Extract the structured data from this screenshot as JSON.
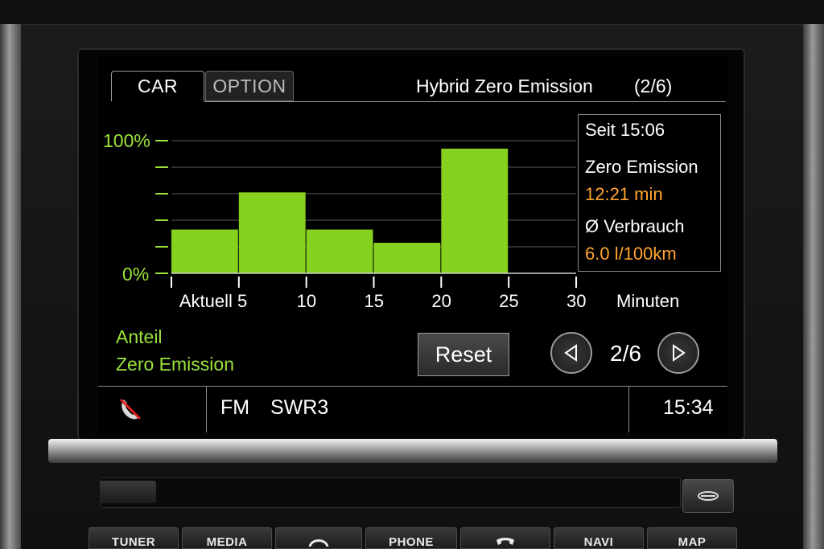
{
  "header": {
    "tabs": [
      {
        "label": "CAR",
        "active": true
      },
      {
        "label": "OPTION",
        "active": false
      }
    ],
    "title": "Hybrid Zero Emission",
    "page_indicator": "(2/6)"
  },
  "chart_data": {
    "type": "bar",
    "y_tick_labels": [
      "100%",
      "0%"
    ],
    "x_tick_labels": [
      "Aktuell 5",
      "10",
      "15",
      "20",
      "25",
      "30"
    ],
    "xlabel": "Minuten",
    "x_range": [
      0,
      30
    ],
    "ylim": [
      0,
      100
    ],
    "bars": [
      {
        "x0": 0,
        "x1": 5,
        "value": 33
      },
      {
        "x0": 5,
        "x1": 10,
        "value": 61
      },
      {
        "x0": 10,
        "x1": 15,
        "value": 33
      },
      {
        "x0": 15,
        "x1": 20,
        "value": 23
      },
      {
        "x0": 20,
        "x1": 25,
        "value": 94
      }
    ],
    "bar_color": "#86d11f",
    "grid": true
  },
  "info": {
    "since": "Seit 15:06",
    "zero_emission_label": "Zero Emission",
    "zero_emission_value": "12:21 min",
    "consumption_label": "Ø Verbrauch",
    "consumption_value": "6.0 l/100km"
  },
  "legend": {
    "line1": "Anteil",
    "line2": "Zero Emission"
  },
  "controls": {
    "reset_label": "Reset",
    "page_count": "2/6"
  },
  "status_bar": {
    "band": "FM",
    "station": "SWR3",
    "clock": "15:34"
  },
  "hardware_buttons": [
    "TUNER",
    "MEDIA",
    "PHONE",
    "NAVI",
    "MAP"
  ],
  "colors": {
    "accent_green": "#9be33a",
    "value_orange": "#ffa531"
  },
  "icons": {
    "phone_disabled": "phone-crossed-icon",
    "prev": "triangle-left-icon",
    "next": "triangle-right-icon"
  }
}
